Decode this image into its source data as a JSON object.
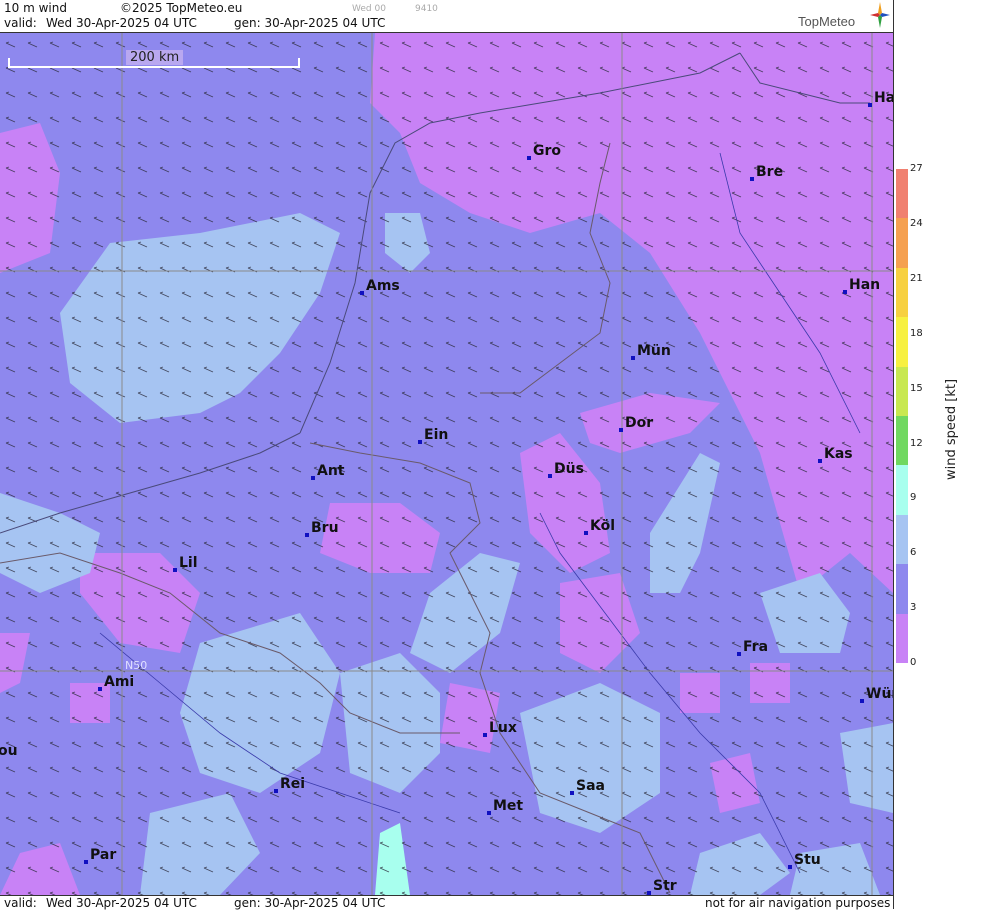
{
  "header": {
    "product": "10 m wind",
    "copyright": "©2025 TopMeteo.eu",
    "valid_label": "valid:",
    "valid_value": "Wed  30-Apr-2025  04 UTC",
    "gen_value": "gen: 30-Apr-2025 04 UTC",
    "faint_run": "Wed 00",
    "faint_code": "9410",
    "logo_text": "TopMeteo"
  },
  "footer": {
    "valid_label": "valid:",
    "valid_value": "Wed  30-Apr-2025  04 UTC",
    "gen_value": "gen: 30-Apr-2025 04 UTC",
    "disclaimer": "not for air navigation purposes"
  },
  "scale_bar": {
    "label": "200 km"
  },
  "grid_label": "N50",
  "cities": [
    {
      "name": "Ha"
    },
    {
      "name": "Gro"
    },
    {
      "name": "Bre"
    },
    {
      "name": "Ams"
    },
    {
      "name": "Han"
    },
    {
      "name": "Mün"
    },
    {
      "name": "Dor"
    },
    {
      "name": "Ein"
    },
    {
      "name": "Ant"
    },
    {
      "name": "Düs"
    },
    {
      "name": "Kas"
    },
    {
      "name": "Bru"
    },
    {
      "name": "Köl"
    },
    {
      "name": "Lil"
    },
    {
      "name": "Fra"
    },
    {
      "name": "Ami"
    },
    {
      "name": "Wür"
    },
    {
      "name": "Lux"
    },
    {
      "name": "ou"
    },
    {
      "name": "Rei"
    },
    {
      "name": "Saa"
    },
    {
      "name": "Met"
    },
    {
      "name": "Par"
    },
    {
      "name": "Stu"
    },
    {
      "name": "Str"
    }
  ],
  "legend": {
    "unit": "wind speed  [kt]",
    "ticks": [
      "27",
      "24",
      "21",
      "18",
      "15",
      "12",
      "9",
      "6",
      "3",
      "0"
    ],
    "colors": [
      "#f08070",
      "#f5a050",
      "#f7d040",
      "#f7f040",
      "#c8e850",
      "#70d860",
      "#a8ffee",
      "#a6c4f2",
      "#8e88ee",
      "#c882f6"
    ]
  },
  "colors": {
    "calm": "#c882f6",
    "light": "#8e88ee",
    "moderate": "#a6c4f2",
    "fresh": "#a8ffee"
  }
}
